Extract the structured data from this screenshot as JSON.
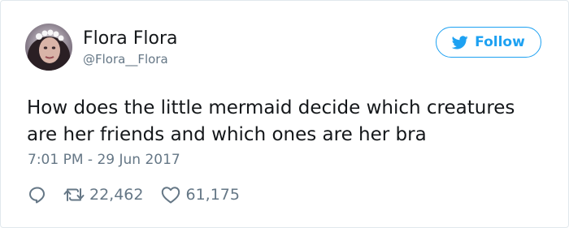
{
  "author": {
    "name": "Flora Flora",
    "handle": "@Flora__Flora"
  },
  "follow_button": {
    "label": "Follow",
    "icon": "twitter-bird-icon",
    "color": "#1da1f2"
  },
  "tweet": {
    "text_lines": [
      "How does the little mermaid decide which creatures",
      "are her friends and which ones are her bra"
    ],
    "timestamp": "7:01 PM - 29 Jun 2017"
  },
  "actions": {
    "reply": {
      "icon": "reply-icon"
    },
    "retweet": {
      "icon": "retweet-icon",
      "count": "22,462"
    },
    "like": {
      "icon": "heart-icon",
      "count": "61,175"
    }
  }
}
